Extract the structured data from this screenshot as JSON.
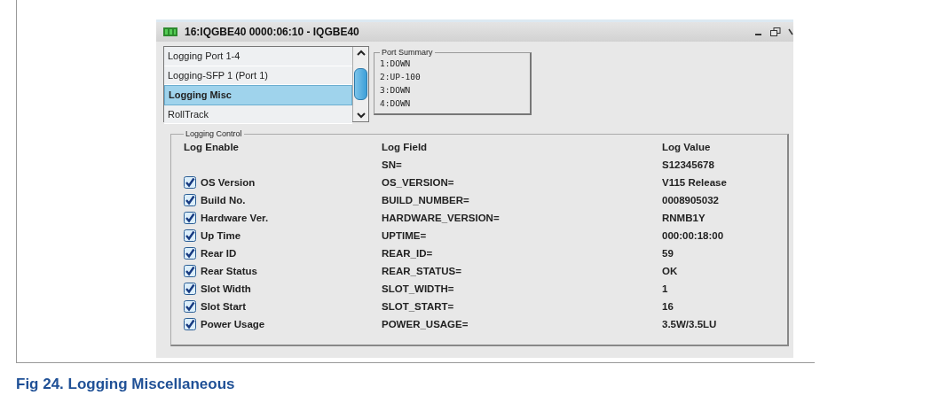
{
  "window": {
    "title": "16:IQGBE40  0000:06:10  - IQGBE40"
  },
  "menu_list": {
    "items": [
      {
        "label": "Logging Port 1-4",
        "selected": false
      },
      {
        "label": "Logging-SFP 1 (Port 1)",
        "selected": false
      },
      {
        "label": "Logging Misc",
        "selected": true
      },
      {
        "label": "RollTrack",
        "selected": false
      }
    ]
  },
  "port_summary": {
    "title": "Port Summary",
    "lines": [
      "1:DOWN",
      "2:UP-100",
      "3:DOWN",
      "4:DOWN"
    ]
  },
  "logging_control": {
    "title": "Logging Control",
    "columns": [
      "Log Enable",
      "Log Field",
      "Log Value"
    ],
    "rows": [
      {
        "kind": "plain",
        "field": "SN=",
        "value": "S12345678"
      },
      {
        "kind": "checkbox",
        "label": "OS Version",
        "checked": true,
        "field": "OS_VERSION=",
        "value": "V115 Release"
      },
      {
        "kind": "checkbox",
        "label": "Build No.",
        "checked": true,
        "field": "BUILD_NUMBER=",
        "value": "0008905032"
      },
      {
        "kind": "checkbox",
        "label": "Hardware Ver.",
        "checked": true,
        "field": "HARDWARE_VERSION=",
        "value": "RNMB1Y"
      },
      {
        "kind": "checkbox",
        "label": "Up Time",
        "checked": true,
        "field": "UPTIME=",
        "value": "000:00:18:00"
      },
      {
        "kind": "checkbox",
        "label": "Rear ID",
        "checked": true,
        "field": "REAR_ID=",
        "value": "59"
      },
      {
        "kind": "checkbox",
        "label": "Rear Status",
        "checked": true,
        "field": "REAR_STATUS=",
        "value": "OK"
      },
      {
        "kind": "checkbox",
        "label": "Slot Width",
        "checked": true,
        "field": "SLOT_WIDTH=",
        "value": "1"
      },
      {
        "kind": "checkbox",
        "label": "Slot Start",
        "checked": true,
        "field": "SLOT_START=",
        "value": "16"
      },
      {
        "kind": "checkbox",
        "label": "Power Usage",
        "checked": true,
        "field": "POWER_USAGE=",
        "value": "3.5W/3.5LU"
      }
    ]
  },
  "caption": "Fig 24.   Logging Miscellaneous"
}
